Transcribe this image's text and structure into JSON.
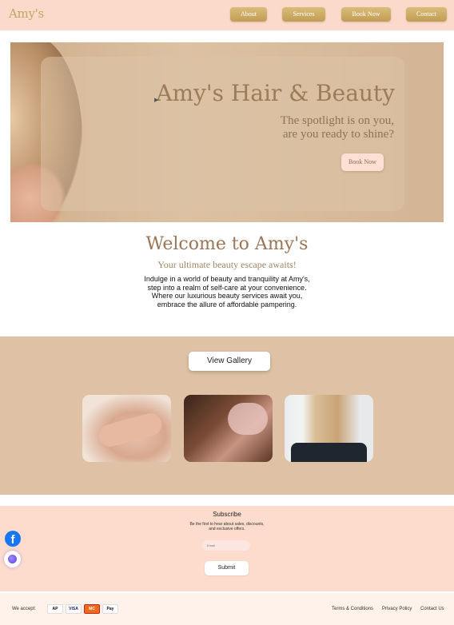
{
  "header": {
    "logo": "Amy's",
    "nav": [
      "About",
      "Services",
      "Book Now",
      "Contact"
    ]
  },
  "hero": {
    "title": "Amy's Hair & Beauty",
    "subtitle_lines": [
      "The spotlight is on you,",
      "are you ready to shine?"
    ],
    "button": "Book Now"
  },
  "welcome": {
    "title": "Welcome to Amy's",
    "tagline": "Your ultimate beauty escape awaits!",
    "body_lines": [
      "Indulge in a world of beauty and tranquility at Amy's,",
      "step into a realm of self-care at your convenience.",
      "Where our luxurious beauty services await you,",
      "embrace the allure of affordable pampering."
    ]
  },
  "gallery": {
    "button": "View Gallery"
  },
  "subscribe": {
    "title": "Subscribe",
    "text_lines": [
      "Be the first to hear about sales, discounts,",
      "and exclusive offers."
    ],
    "email_placeholder": "Email",
    "submit": "Submit"
  },
  "social": {
    "facebook_glyph": "f"
  },
  "footer": {
    "accept_label": "We accept:",
    "cards": [
      "AP",
      "VISA",
      "MC",
      "Pay"
    ],
    "links": [
      "Terms & Conditions",
      "Privacy Policy",
      "Contact Us"
    ]
  },
  "colors": {
    "header_bg": "#fbd9cb",
    "gold": "#c9a460",
    "gallery_bg": "#dfc2a5",
    "subscribe_bg": "#fddccd",
    "footer_bg": "#fff2ea"
  }
}
